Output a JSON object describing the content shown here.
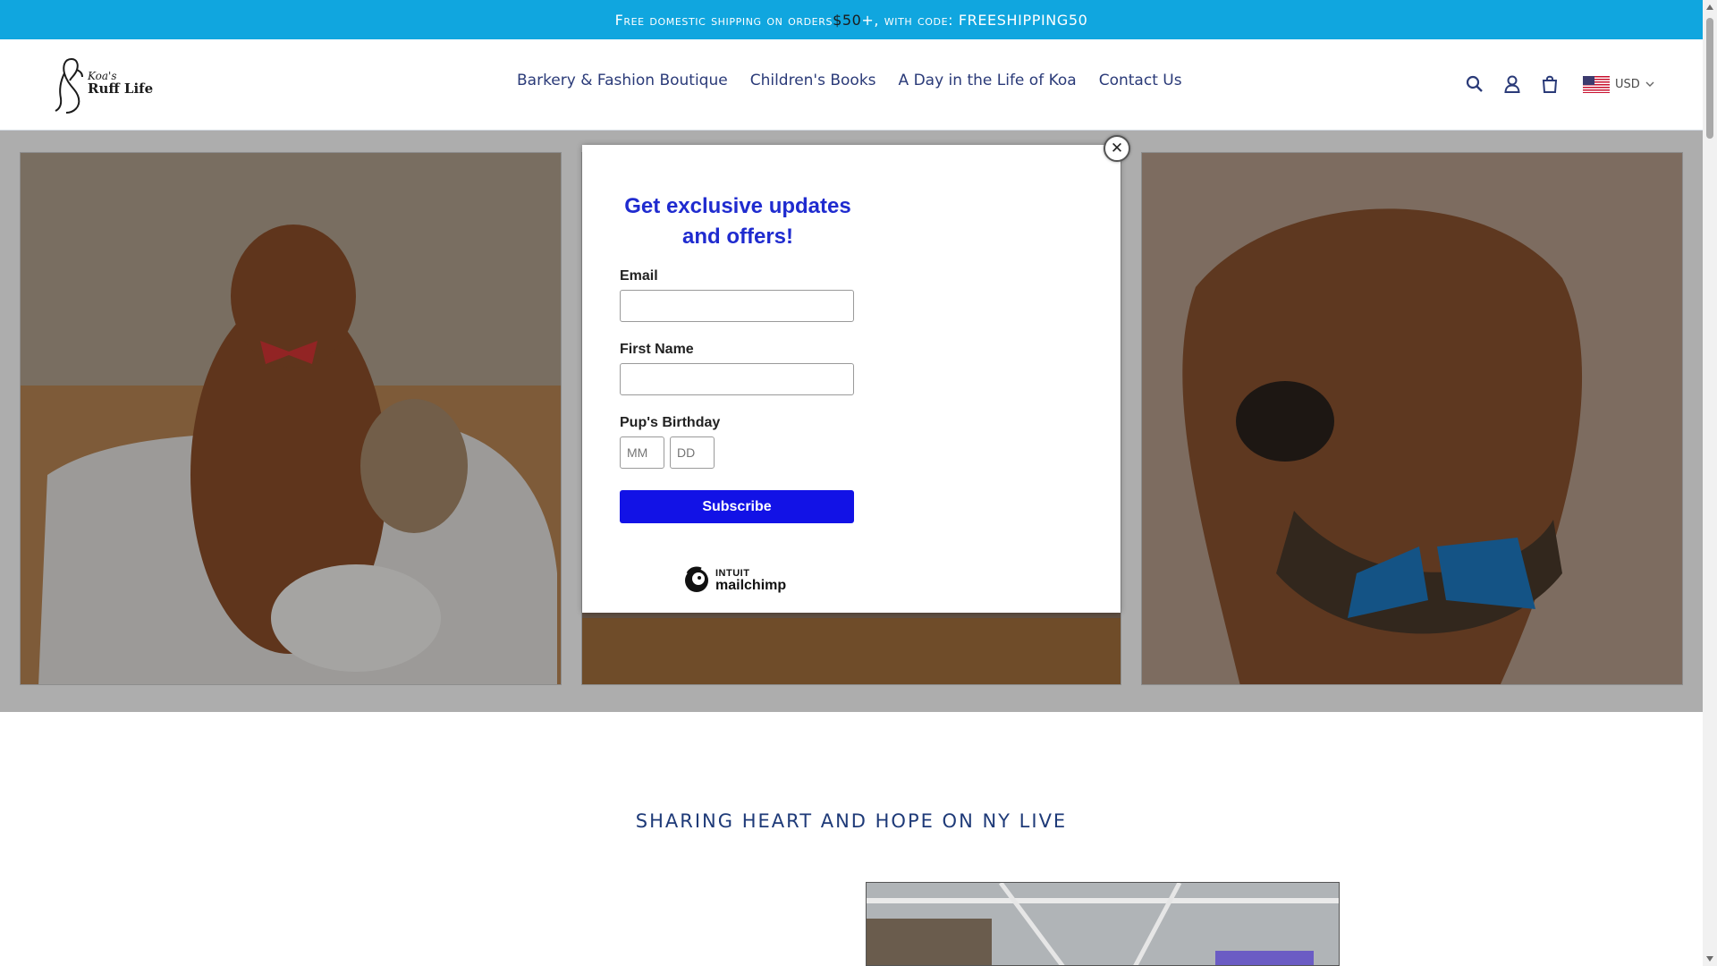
{
  "announcement": {
    "prefix": "Free domestic shipping on orders ",
    "price": "$50",
    "suffix": "+, with code: FREESHIPPING50"
  },
  "header": {
    "logo_small": "Koa's",
    "logo_main": "Ruff Life",
    "nav": [
      {
        "label": "Barkery & Fashion Boutique"
      },
      {
        "label": "Children's Books"
      },
      {
        "label": "A Day in the Life of Koa"
      },
      {
        "label": "Contact Us"
      }
    ],
    "tools": {
      "search_icon": "search-icon",
      "account_icon": "account-icon",
      "cart_icon": "cart-icon",
      "currency": "USD"
    }
  },
  "popup": {
    "close_label": "✕",
    "title": "Get exclusive updates and offers!",
    "email_label": "Email",
    "email_value": "",
    "first_name_label": "First Name",
    "first_name_value": "",
    "birthday_label": "Pup's Birthday",
    "mm_placeholder": "MM",
    "dd_placeholder": "DD",
    "subscribe_label": "Subscribe",
    "brand_small": "INTUIT",
    "brand_main": "mailchimp"
  },
  "section": {
    "title": "SHARING HEART AND HOPE ON NY LIVE"
  },
  "colors": {
    "announcement_bg": "#10a6df",
    "nav_text": "#2a3a78",
    "popup_title": "#1f2bcf",
    "subscribe_bg": "#1212e6",
    "section_title": "#1e3a78"
  }
}
